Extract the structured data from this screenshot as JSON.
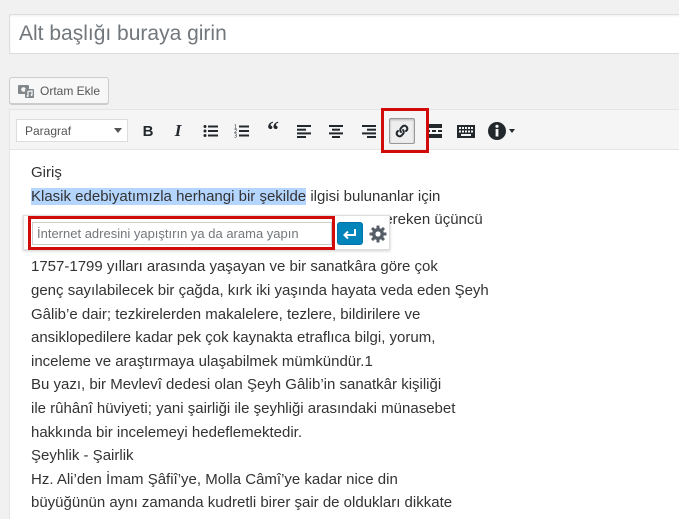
{
  "title": {
    "placeholder": "Alt başlığı buraya girin",
    "value": ""
  },
  "media_button": {
    "label": "Ortam Ekle",
    "icon": "camera-music-icon"
  },
  "toolbar": {
    "format_select": "Paragraf",
    "buttons": [
      {
        "name": "bold",
        "glyph": "B"
      },
      {
        "name": "italic",
        "glyph": "I"
      },
      {
        "name": "bulleted-list",
        "icon": "bulleted-list-icon"
      },
      {
        "name": "numbered-list",
        "icon": "numbered-list-icon"
      },
      {
        "name": "blockquote",
        "glyph": "“"
      },
      {
        "name": "align-left",
        "icon": "align-left-icon"
      },
      {
        "name": "align-center",
        "icon": "align-center-icon"
      },
      {
        "name": "align-right",
        "icon": "align-right-icon"
      },
      {
        "name": "insert-link",
        "icon": "link-icon",
        "active": true
      },
      {
        "name": "read-more",
        "icon": "read-more-icon"
      },
      {
        "name": "toolbar-toggle",
        "icon": "keyboard-icon"
      },
      {
        "name": "help",
        "icon": "info-icon"
      }
    ]
  },
  "content": {
    "lines": [
      {
        "text": "Giriş"
      },
      {
        "selected": "Klasik edebiyatımızla herhangi bir şekilde",
        "rest": " ilgisi bulunanlar için"
      },
      {
        "hidden_start": "",
        "text": "gereken üçüncü"
      },
      {
        "text": ""
      },
      {
        "text": "1757-1799 yılları arasında yaşayan ve bir sanatkâra göre çok"
      },
      {
        "text": "genç sayılabilecek bir çağda, kırk iki yaşında hayata veda eden Şeyh"
      },
      {
        "text": "Gâlib’e dair; tezkirelerden makalelere, tezlere, bildirilere ve"
      },
      {
        "text": "ansiklopedilere kadar pek çok kaynakta etraflıca bilgi, yorum,"
      },
      {
        "text": "inceleme ve araştırmaya ulaşabilmek mümkündür.1"
      },
      {
        "text": "Bu yazı, bir Mevlevî dedesi olan Şeyh Gâlib’in sanatkâr kişiliği"
      },
      {
        "text": "ile rûhânî hüviyeti; yani şairliği ile şeyhliği arasındaki münasebet"
      },
      {
        "text": "hakkında bir incelemeyi hedeflemektedir."
      },
      {
        "text": "Şeyhlik - Şairlik"
      },
      {
        "text": "Hz. Ali’den İmam Şâfiî’ye, Molla Câmî’ye kadar nice din"
      },
      {
        "text": "büyüğünün aynı zamanda kudretli birer şair de oldukları dikkate"
      }
    ]
  },
  "link_popup": {
    "placeholder": "İnternet adresini yapıştırın ya da arama yapın",
    "value": "",
    "apply_icon": "enter-icon",
    "settings_icon": "gear-icon"
  },
  "colors": {
    "highlight": "#d10a0a",
    "selection": "#b4d5fe",
    "apply_button": "#0085ba"
  }
}
